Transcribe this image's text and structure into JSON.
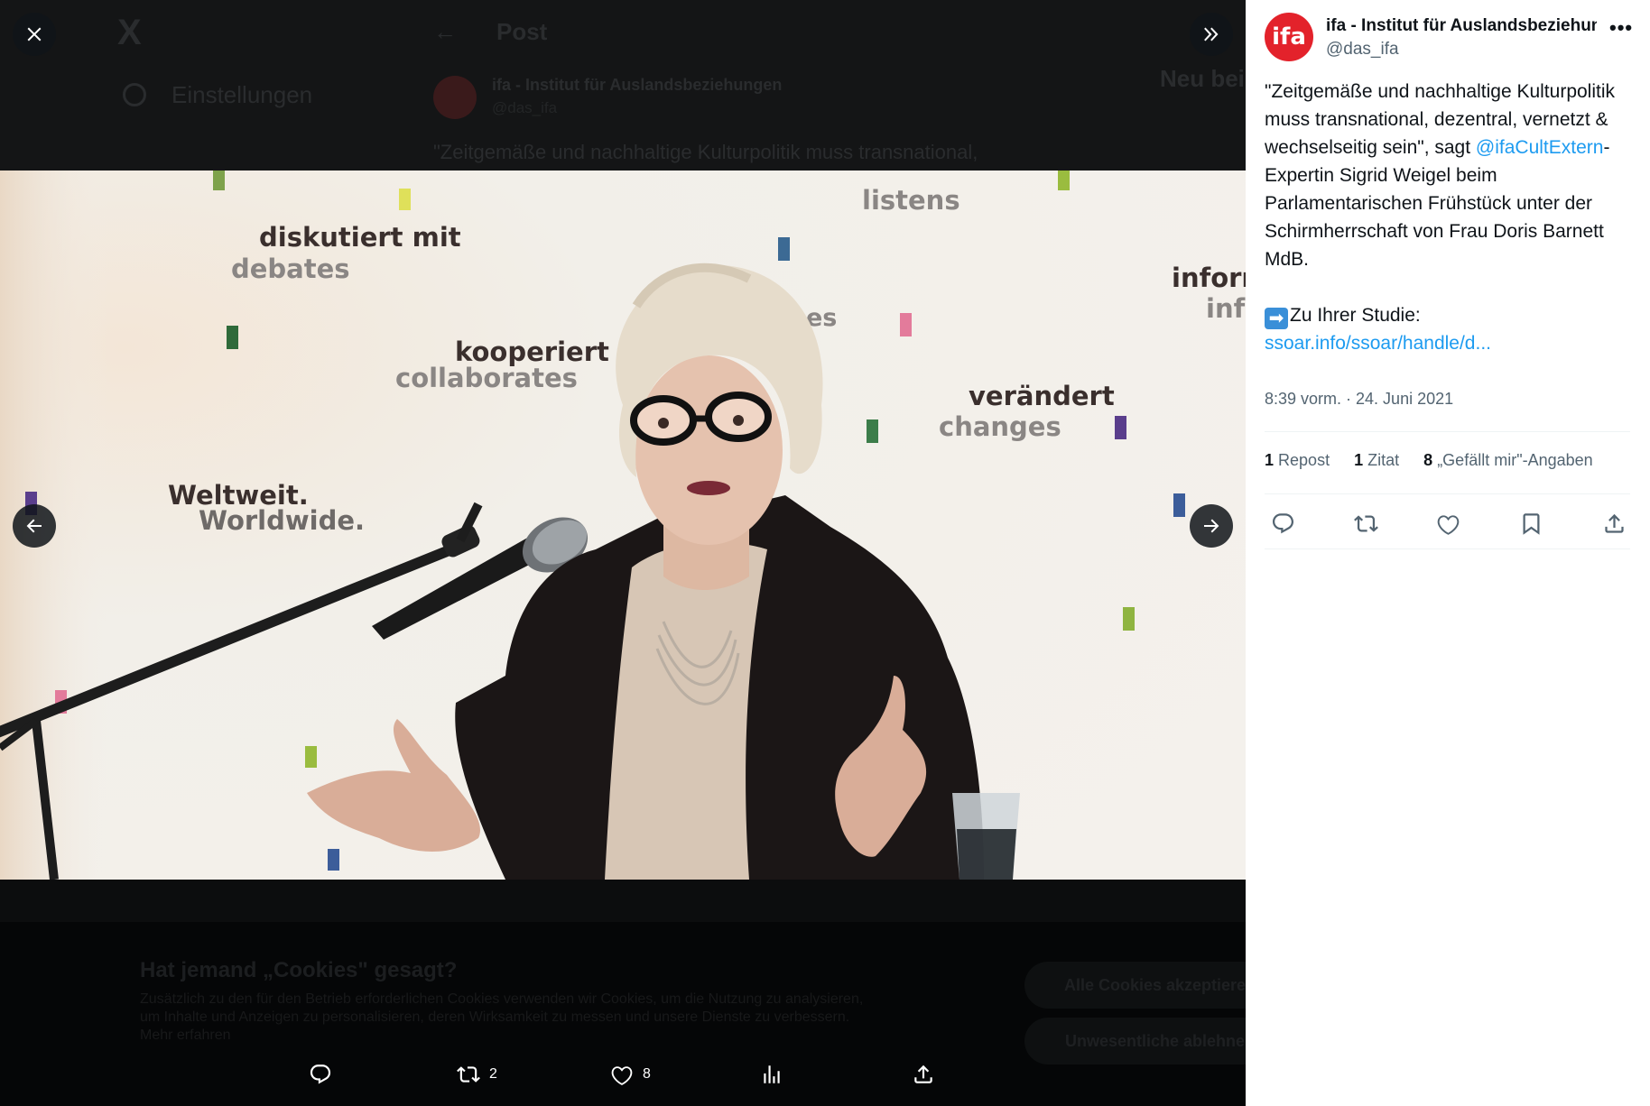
{
  "background_page": {
    "app_logo": "X",
    "nav_settings": "Einstellungen",
    "header_title": "Post",
    "author_name": "ifa - Institut für Auslandsbeziehungen",
    "author_handle": "@das_ifa",
    "quote_preview": "\"Zeitgemäße und nachhaltige Kulturpolitik muss transnational,",
    "news_heading": "Neu bei X?",
    "cookie_title": "Hat jemand „Cookies\" gesagt?",
    "cookie_text": "Zusätzlich zu den für den Betrieb erforderlichen Cookies verwenden wir Cookies, um die Nutzung zu analysieren, um Inhalte und Anzeigen zu personalisieren, deren Wirksamkeit zu messen und unsere Dienste zu verbessern. Mehr erfahren",
    "cookie_accept": "Alle Cookies akzeptieren",
    "cookie_refuse": "Unwesentliche ablehnen"
  },
  "photo": {
    "wall_words": [
      "diskutiert mit",
      "debates",
      "listens",
      "kooperiert",
      "collaborates",
      "verändert",
      "changes",
      "Weltweit.",
      "Worldwide.",
      "inform",
      "inf",
      "es"
    ]
  },
  "viewer": {
    "close_icon": "close-icon",
    "collapse_icon": "double-chevron-right-icon",
    "prev_icon": "arrow-left-icon",
    "next_icon": "arrow-right-icon",
    "actions": {
      "reply_count": "",
      "repost_count": "2",
      "like_count": "8",
      "views_count": "",
      "share": ""
    }
  },
  "sidebar": {
    "author_name": "ifa - Institut für Auslandsbeziehungen",
    "author_handle": "@das_ifa",
    "avatar_text": "ifa",
    "more_label": "•••",
    "text_part1": "\"Zeitgemäße und nachhaltige Kulturpolitik muss transnational, dezentral, vernetzt & wechselseitig sein\", sagt ",
    "mention": "@ifaCultExtern",
    "text_part2": "-Expertin Sigrid Weigel beim Parlamentarischen Frühstück unter der Schirmherrschaft von Frau Doris Barnett MdB.",
    "arrow_emoji": "➡",
    "study_label": "Zu Ihrer Studie:",
    "study_link": "ssoar.info/ssoar/handle/d...",
    "timestamp": "8:39 vorm. · 24. Juni 2021",
    "stats": {
      "repost_count": "1",
      "repost_label": "Repost",
      "quote_count": "1",
      "quote_label": "Zitat",
      "like_count": "8",
      "like_label": "„Gefällt mir\"-Angaben"
    }
  }
}
